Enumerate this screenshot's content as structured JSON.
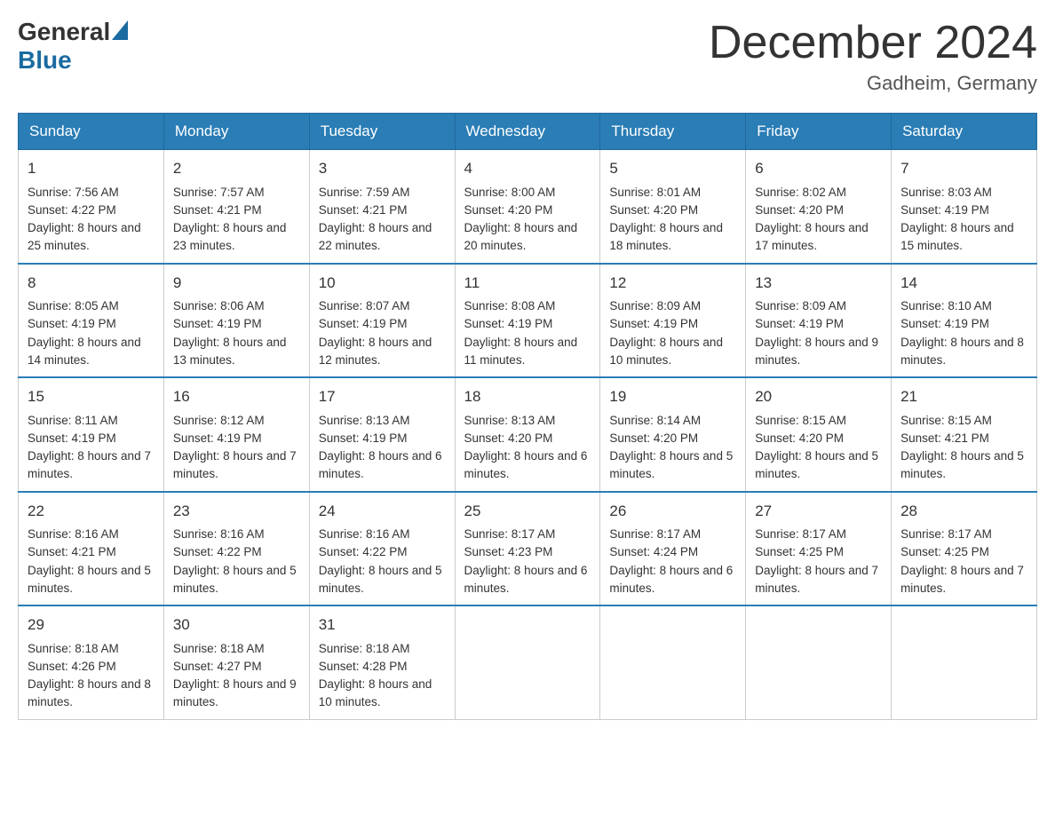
{
  "logo": {
    "general": "General",
    "blue": "Blue"
  },
  "title": "December 2024",
  "location": "Gadheim, Germany",
  "days": [
    "Sunday",
    "Monday",
    "Tuesday",
    "Wednesday",
    "Thursday",
    "Friday",
    "Saturday"
  ],
  "weeks": [
    [
      {
        "day": "1",
        "sunrise": "7:56 AM",
        "sunset": "4:22 PM",
        "daylight": "8 hours and 25 minutes."
      },
      {
        "day": "2",
        "sunrise": "7:57 AM",
        "sunset": "4:21 PM",
        "daylight": "8 hours and 23 minutes."
      },
      {
        "day": "3",
        "sunrise": "7:59 AM",
        "sunset": "4:21 PM",
        "daylight": "8 hours and 22 minutes."
      },
      {
        "day": "4",
        "sunrise": "8:00 AM",
        "sunset": "4:20 PM",
        "daylight": "8 hours and 20 minutes."
      },
      {
        "day": "5",
        "sunrise": "8:01 AM",
        "sunset": "4:20 PM",
        "daylight": "8 hours and 18 minutes."
      },
      {
        "day": "6",
        "sunrise": "8:02 AM",
        "sunset": "4:20 PM",
        "daylight": "8 hours and 17 minutes."
      },
      {
        "day": "7",
        "sunrise": "8:03 AM",
        "sunset": "4:19 PM",
        "daylight": "8 hours and 15 minutes."
      }
    ],
    [
      {
        "day": "8",
        "sunrise": "8:05 AM",
        "sunset": "4:19 PM",
        "daylight": "8 hours and 14 minutes."
      },
      {
        "day": "9",
        "sunrise": "8:06 AM",
        "sunset": "4:19 PM",
        "daylight": "8 hours and 13 minutes."
      },
      {
        "day": "10",
        "sunrise": "8:07 AM",
        "sunset": "4:19 PM",
        "daylight": "8 hours and 12 minutes."
      },
      {
        "day": "11",
        "sunrise": "8:08 AM",
        "sunset": "4:19 PM",
        "daylight": "8 hours and 11 minutes."
      },
      {
        "day": "12",
        "sunrise": "8:09 AM",
        "sunset": "4:19 PM",
        "daylight": "8 hours and 10 minutes."
      },
      {
        "day": "13",
        "sunrise": "8:09 AM",
        "sunset": "4:19 PM",
        "daylight": "8 hours and 9 minutes."
      },
      {
        "day": "14",
        "sunrise": "8:10 AM",
        "sunset": "4:19 PM",
        "daylight": "8 hours and 8 minutes."
      }
    ],
    [
      {
        "day": "15",
        "sunrise": "8:11 AM",
        "sunset": "4:19 PM",
        "daylight": "8 hours and 7 minutes."
      },
      {
        "day": "16",
        "sunrise": "8:12 AM",
        "sunset": "4:19 PM",
        "daylight": "8 hours and 7 minutes."
      },
      {
        "day": "17",
        "sunrise": "8:13 AM",
        "sunset": "4:19 PM",
        "daylight": "8 hours and 6 minutes."
      },
      {
        "day": "18",
        "sunrise": "8:13 AM",
        "sunset": "4:20 PM",
        "daylight": "8 hours and 6 minutes."
      },
      {
        "day": "19",
        "sunrise": "8:14 AM",
        "sunset": "4:20 PM",
        "daylight": "8 hours and 5 minutes."
      },
      {
        "day": "20",
        "sunrise": "8:15 AM",
        "sunset": "4:20 PM",
        "daylight": "8 hours and 5 minutes."
      },
      {
        "day": "21",
        "sunrise": "8:15 AM",
        "sunset": "4:21 PM",
        "daylight": "8 hours and 5 minutes."
      }
    ],
    [
      {
        "day": "22",
        "sunrise": "8:16 AM",
        "sunset": "4:21 PM",
        "daylight": "8 hours and 5 minutes."
      },
      {
        "day": "23",
        "sunrise": "8:16 AM",
        "sunset": "4:22 PM",
        "daylight": "8 hours and 5 minutes."
      },
      {
        "day": "24",
        "sunrise": "8:16 AM",
        "sunset": "4:22 PM",
        "daylight": "8 hours and 5 minutes."
      },
      {
        "day": "25",
        "sunrise": "8:17 AM",
        "sunset": "4:23 PM",
        "daylight": "8 hours and 6 minutes."
      },
      {
        "day": "26",
        "sunrise": "8:17 AM",
        "sunset": "4:24 PM",
        "daylight": "8 hours and 6 minutes."
      },
      {
        "day": "27",
        "sunrise": "8:17 AM",
        "sunset": "4:25 PM",
        "daylight": "8 hours and 7 minutes."
      },
      {
        "day": "28",
        "sunrise": "8:17 AM",
        "sunset": "4:25 PM",
        "daylight": "8 hours and 7 minutes."
      }
    ],
    [
      {
        "day": "29",
        "sunrise": "8:18 AM",
        "sunset": "4:26 PM",
        "daylight": "8 hours and 8 minutes."
      },
      {
        "day": "30",
        "sunrise": "8:18 AM",
        "sunset": "4:27 PM",
        "daylight": "8 hours and 9 minutes."
      },
      {
        "day": "31",
        "sunrise": "8:18 AM",
        "sunset": "4:28 PM",
        "daylight": "8 hours and 10 minutes."
      },
      null,
      null,
      null,
      null
    ]
  ]
}
